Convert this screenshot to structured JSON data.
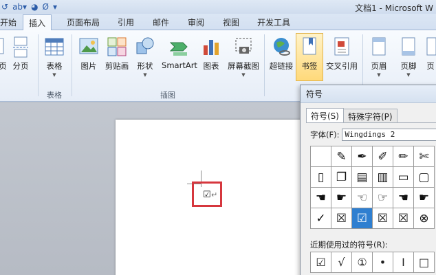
{
  "titlebar": {
    "quick_access": [
      "↺",
      "ab▾",
      "◕",
      "Ø",
      "▾"
    ],
    "doc_title": "文档1 - Microsoft W"
  },
  "tabs": [
    {
      "label": "开始"
    },
    {
      "label": "插入",
      "active": true
    },
    {
      "label": "页面布局"
    },
    {
      "label": "引用"
    },
    {
      "label": "邮件"
    },
    {
      "label": "审阅"
    },
    {
      "label": "视图"
    },
    {
      "label": "开发工具"
    }
  ],
  "ribbon": {
    "buttons": {
      "page": "页",
      "page_break": "分页",
      "table": "表格",
      "picture": "图片",
      "clipart": "剪贴画",
      "shapes": "形状",
      "smartart": "SmartArt",
      "chart": "图表",
      "screenshot": "屏幕截图",
      "hyperlink": "超链接",
      "bookmark": "书签",
      "crossref": "交叉引用",
      "header": "页眉",
      "footer": "页脚",
      "pagenum": "页"
    },
    "groups": {
      "tables": "表格",
      "illustrations": "插图"
    },
    "colors": {
      "accent": "#2b5ca8",
      "highlight": "#ffd97a"
    }
  },
  "document": {
    "inserted_symbol": "☑",
    "paragraph_mark": "↵",
    "highlight_color": "#d6373e"
  },
  "dialog": {
    "title": "符号",
    "tabs": [
      "符号(S)",
      "特殊字符(P)"
    ],
    "font_label": "字体(F):",
    "font_value": "Wingdings 2",
    "grid": [
      [
        "",
        "✎",
        "✒",
        "✐",
        "✏",
        "✄"
      ],
      [
        "▯",
        "❐",
        "▤",
        "▥",
        "▭",
        "▢"
      ],
      [
        "☚",
        "☛",
        "☜",
        "☞",
        "☚",
        "☛"
      ],
      [
        "✓",
        "☒",
        "☑",
        "☒",
        "☒",
        "⊗"
      ]
    ],
    "selected_cell": "3.2",
    "recent_label": "近期使用过的符号(R):",
    "recent": [
      "☑",
      "√",
      "①",
      "•",
      "I",
      "□"
    ],
    "selection_color": "#2f7fd0"
  }
}
